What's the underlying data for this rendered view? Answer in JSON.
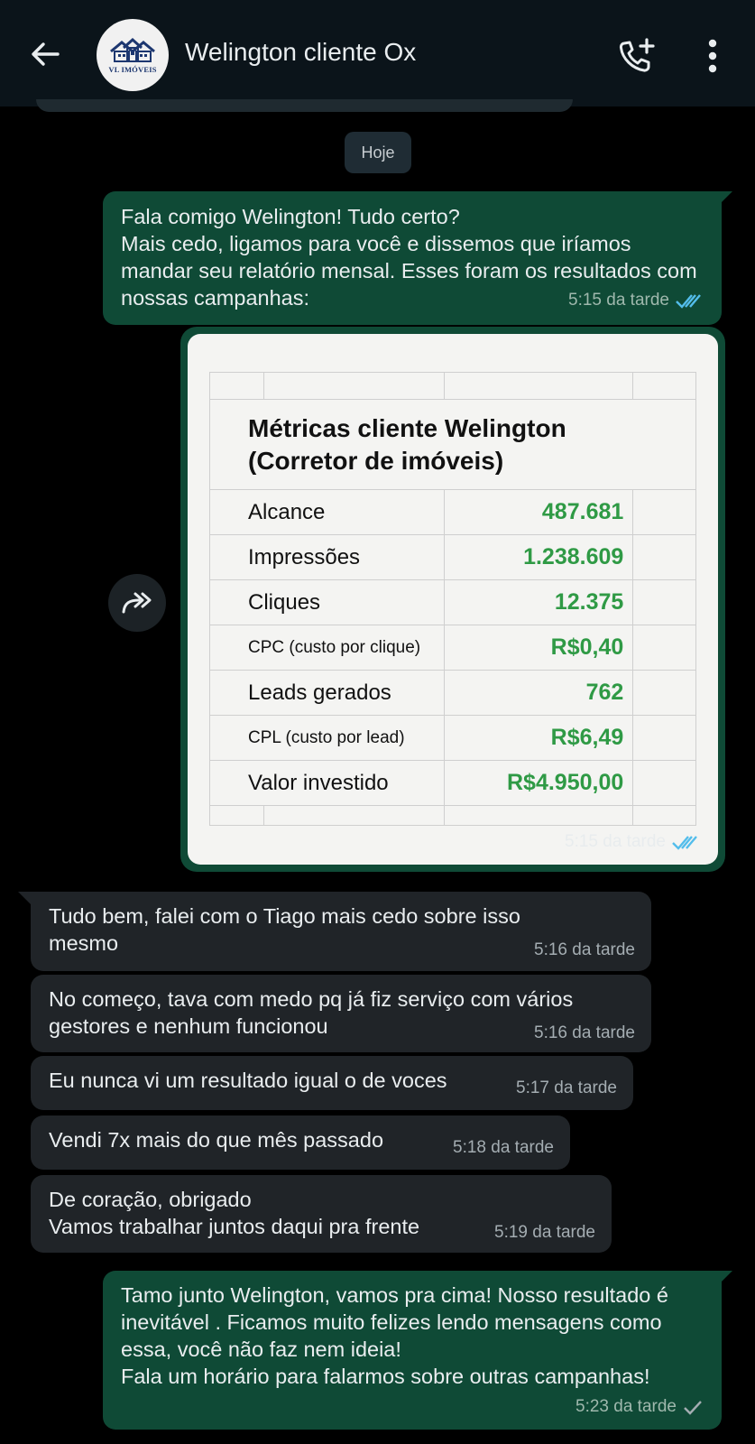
{
  "header": {
    "title": "Welington cliente Ox",
    "avatar_text": "VL IMÓVEIS",
    "icons": {
      "back": "arrow-left-icon",
      "call": "add-call-icon",
      "menu": "more-vertical-icon"
    }
  },
  "date_chip": "Hoje",
  "messages": [
    {
      "direction": "out",
      "text": "Fala comigo Welington! Tudo certo?\nMais cedo, ligamos para você e dissemos que iríamos mandar seu relatório mensal. Esses foram os resultados com nossas campanhas:",
      "time": "5:15 da tarde",
      "status": "read"
    },
    {
      "direction": "out",
      "type": "image",
      "time": "5:15 da tarde",
      "status": "read",
      "image": {
        "title": "Métricas cliente Welington (Corretor de imóveis)",
        "rows": [
          {
            "label": "Alcance",
            "value": "487.681"
          },
          {
            "label": "Impressões",
            "value": "1.238.609"
          },
          {
            "label": "Cliques",
            "value": "12.375"
          },
          {
            "label": "CPC (custo por clique)",
            "value": "R$0,40"
          },
          {
            "label": "Leads gerados",
            "value": "762"
          },
          {
            "label": "CPL (custo por lead)",
            "value": "R$6,49"
          },
          {
            "label": "Valor investido",
            "value": "R$4.950,00"
          }
        ]
      }
    },
    {
      "direction": "in",
      "text": "Tudo bem, falei com o Tiago mais cedo sobre isso mesmo",
      "time": "5:16 da tarde"
    },
    {
      "direction": "in",
      "text": "No começo, tava com medo pq já fiz serviço com vários gestores e nenhum funcionou",
      "time": "5:16 da tarde"
    },
    {
      "direction": "in",
      "text": "Eu nunca vi um resultado igual o de voces",
      "time": "5:17 da tarde"
    },
    {
      "direction": "in",
      "text": "Vendi 7x mais do que mês passado",
      "time": "5:18 da tarde"
    },
    {
      "direction": "in",
      "text": "De coração, obrigado\nVamos trabalhar juntos daqui pra frente",
      "time": "5:19 da tarde"
    },
    {
      "direction": "out",
      "text": "Tamo junto Welington, vamos pra cima! Nosso resultado é inevitável . Ficamos muito felizes lendo mensagens como essa, você não faz nem ideia!\nFala um horário para falarmos sobre outras campanhas!",
      "time": "5:23 da tarde",
      "status": "sent"
    }
  ],
  "colors": {
    "header_bg": "#0b141a",
    "outgoing_bubble": "#0f4a36",
    "incoming_bubble": "#202428",
    "read_tick": "#53bdeb",
    "metric_value": "#2f9a45"
  }
}
